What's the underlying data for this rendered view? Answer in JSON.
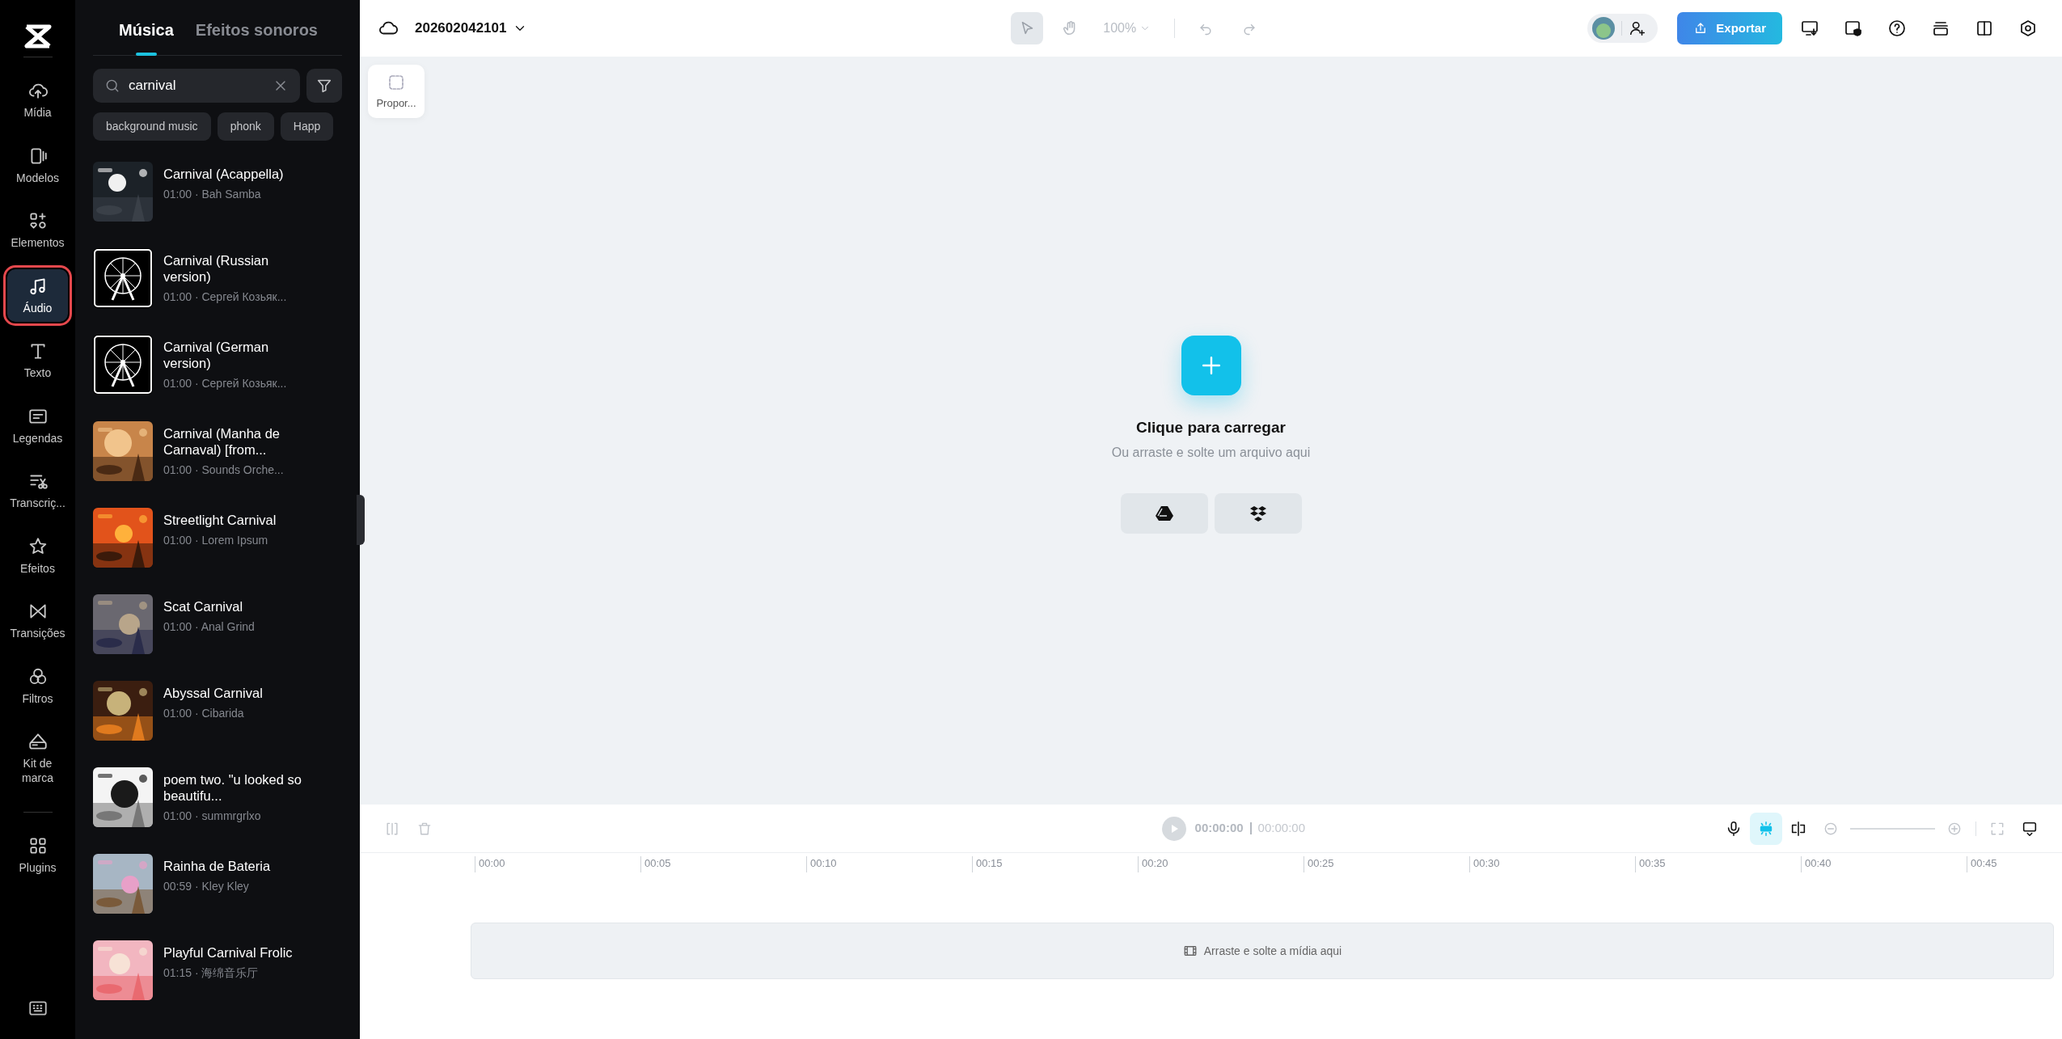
{
  "rail": {
    "items": [
      {
        "label": "Mídia",
        "selected": false,
        "outlined": false
      },
      {
        "label": "Modelos",
        "selected": false,
        "outlined": false
      },
      {
        "label": "Elementos",
        "selected": false,
        "outlined": false
      },
      {
        "label": "Áudio",
        "selected": true,
        "outlined": true
      },
      {
        "label": "Texto",
        "selected": false,
        "outlined": false
      },
      {
        "label": "Legendas",
        "selected": false,
        "outlined": false
      },
      {
        "label": "Transcriç...",
        "selected": false,
        "outlined": false
      },
      {
        "label": "Efeitos",
        "selected": false,
        "outlined": false
      },
      {
        "label": "Transições",
        "selected": false,
        "outlined": false
      },
      {
        "label": "Filtros",
        "selected": false,
        "outlined": false
      },
      {
        "label": "Kit de marca",
        "selected": false,
        "outlined": false
      },
      {
        "label": "Plugins",
        "selected": false,
        "outlined": false
      }
    ]
  },
  "panel": {
    "tabs": [
      {
        "label": "Música",
        "selected": true
      },
      {
        "label": "Efeitos sonoros",
        "selected": false
      }
    ],
    "search": {
      "value": "carnival"
    },
    "tags": [
      "background music",
      "phonk",
      "Happ"
    ],
    "songs": [
      {
        "title": "Carnival (Acappella)",
        "meta": "01:00 · Bah Samba"
      },
      {
        "title": "Carnival (Russian version)",
        "meta": "01:00 · Сергей Козьяк..."
      },
      {
        "title": "Carnival (German version)",
        "meta": "01:00 · Сергей Козьяк..."
      },
      {
        "title": "Carnival (Manha de Carnaval) [from...",
        "meta": "01:00 · Sounds Orche..."
      },
      {
        "title": "Streetlight Carnival",
        "meta": "01:00 · Lorem Ipsum"
      },
      {
        "title": "Scat Carnival",
        "meta": "01:00 · Anal Grind"
      },
      {
        "title": "Abyssal Carnival",
        "meta": "01:00 · Cibarida"
      },
      {
        "title": "poem two. \"u looked so beautifu...",
        "meta": "01:00 · summrgrlxo"
      },
      {
        "title": "Rainha de Bateria",
        "meta": "00:59 · Kley Kley"
      },
      {
        "title": "Playful Carnival Frolic",
        "meta": "01:15 · 海绵音乐厅"
      }
    ]
  },
  "topbar": {
    "project_title": "202602042101",
    "zoom": "100%",
    "export": "Exportar"
  },
  "canvas": {
    "ratio_button": "Propor...",
    "upload_title": "Clique para carregar",
    "upload_hint": "Ou arraste e solte um arquivo aqui"
  },
  "timeline": {
    "current_time": "00:00:00",
    "total_time": "00:00:00",
    "toggle_on": true,
    "ticks": [
      "00:00",
      "00:05",
      "00:10",
      "00:15",
      "00:20",
      "00:25",
      "00:30",
      "00:35",
      "00:40",
      "00:45"
    ],
    "drop_hint": "Arraste e solte a mídia aqui"
  }
}
